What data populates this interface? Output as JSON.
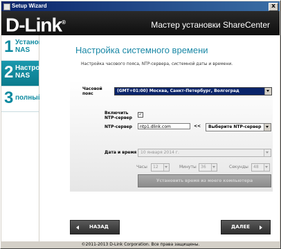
{
  "window": {
    "title": "Setup Wizard",
    "close": "x"
  },
  "header": {
    "logo": "D-Link",
    "trademark": "®",
    "title": "Мастер установки ShareCenter"
  },
  "sidebar": {
    "steps": [
      {
        "num": "1",
        "label": "Установка NAS"
      },
      {
        "num": "2",
        "label": "Настройка NAS"
      },
      {
        "num": "3",
        "label": "полный"
      }
    ]
  },
  "page": {
    "title": "Настройка системного времени",
    "description": "Настройка часового пояса, NTP-сервера, системной даты и времени."
  },
  "form": {
    "timezone_label": "Часовой пояс",
    "timezone_value": "(GMT+01:00) Москва, Санкт-Петербург, Волгоград",
    "ntp_enable_label": "Включить NTP-сервер",
    "ntp_enable_checked": "✓",
    "ntp_server_label": "NTP-сервер",
    "ntp_server_value": "ntp1.dlink.com",
    "ntp_arrows": "<<",
    "ntp_select_value": "Выберите NTP-сервер",
    "datetime_label": "Дата и время",
    "date_value": "10  января  2014 г.",
    "hours_label": "Часы",
    "hours_value": "12",
    "minutes_label": "Минуты",
    "minutes_value": "36",
    "seconds_label": "Секунды",
    "seconds_value": "48",
    "set_time_button": "Установить время из моего компьютера"
  },
  "nav": {
    "back": "НАЗАД",
    "next": "ДАЛЕЕ"
  },
  "footer": {
    "copyright": "©2011-2013 D-Link Corporation. Все права защищены."
  },
  "colors": {
    "accent": "#0d8aa0",
    "active_step": "#1a98ad",
    "selected": "#0a246a"
  }
}
